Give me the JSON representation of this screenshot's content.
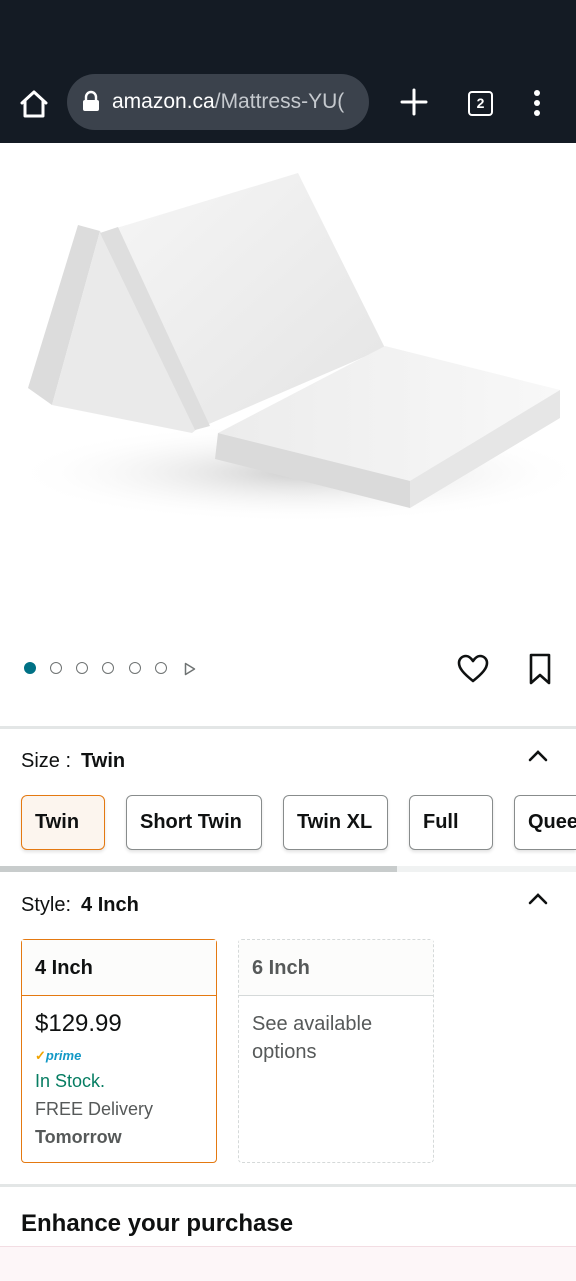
{
  "browser": {
    "url_domain": "amazon.ca",
    "url_path": "/Mattress-YU(",
    "tab_count": "2",
    "icons": [
      "home-icon",
      "lock-icon",
      "plus-icon",
      "tabs-icon",
      "more-vert-icon"
    ],
    "colors": {
      "bar": "#141b24",
      "url_field": "#3b424c"
    }
  },
  "product": {
    "image_alt": "Tri-fold white mattress topper",
    "carousel": {
      "count": 6,
      "active_index": 0
    }
  },
  "size": {
    "label": "Size :",
    "selected": "Twin",
    "options": [
      "Twin",
      "Short Twin",
      "Twin XL",
      "Full",
      "Queen"
    ]
  },
  "style": {
    "label": "Style:",
    "selected": "4 Inch",
    "options": [
      {
        "name": "4 Inch",
        "price": "$129.99",
        "prime_badge": "prime",
        "stock": "In Stock.",
        "delivery": "FREE Delivery",
        "delivery_day": "Tomorrow"
      },
      {
        "name": "6 Inch",
        "note": "See available options"
      }
    ]
  },
  "enhance": {
    "title": "Enhance your purchase"
  },
  "theme": {
    "accent": "#e47911",
    "link": "#007185",
    "in_stock": "#067d62"
  }
}
